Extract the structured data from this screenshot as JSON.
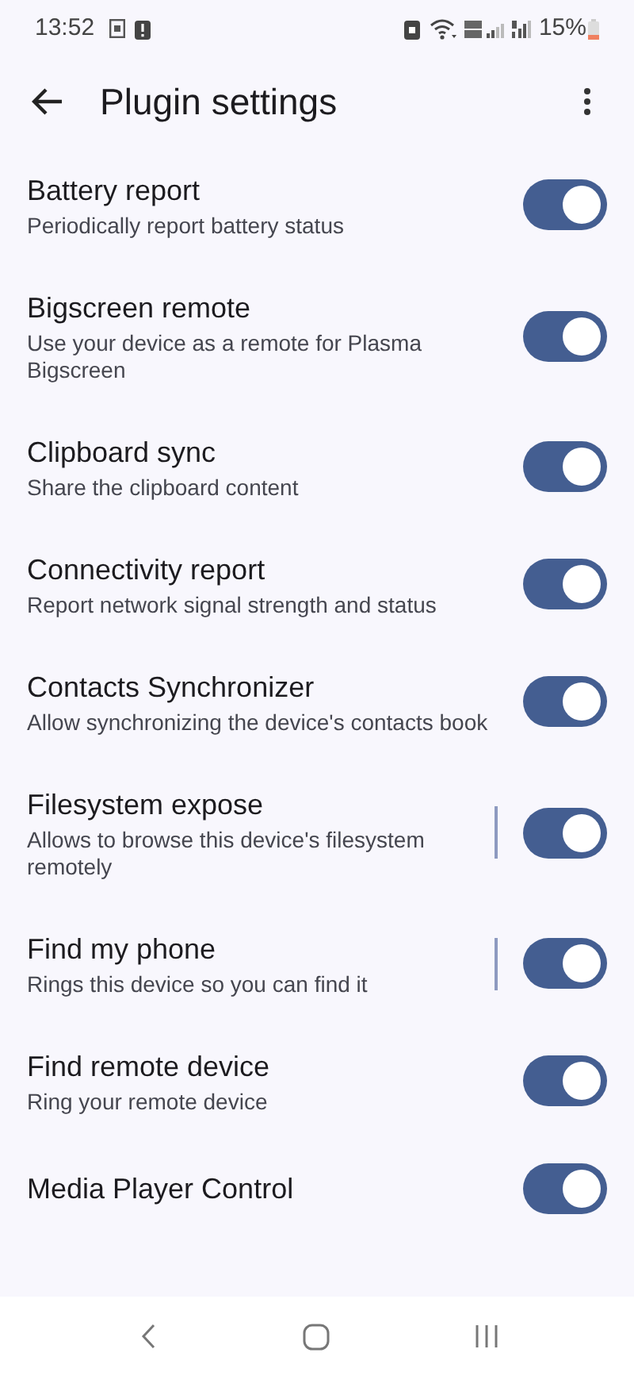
{
  "status_bar": {
    "time": "13:52",
    "battery": "15%"
  },
  "app_bar": {
    "title": "Plugin settings"
  },
  "plugins": [
    {
      "title": "Battery report",
      "subtitle": "Periodically report battery status",
      "on": true,
      "has_settings": false
    },
    {
      "title": "Bigscreen remote",
      "subtitle": "Use your device as a remote for Plasma Bigscreen",
      "on": true,
      "has_settings": false
    },
    {
      "title": "Clipboard sync",
      "subtitle": "Share the clipboard content",
      "on": true,
      "has_settings": false
    },
    {
      "title": "Connectivity report",
      "subtitle": "Report network signal strength and status",
      "on": true,
      "has_settings": false
    },
    {
      "title": "Contacts Synchronizer",
      "subtitle": "Allow synchronizing the device's contacts book",
      "on": true,
      "has_settings": false
    },
    {
      "title": "Filesystem expose",
      "subtitle": "Allows to browse this device's filesystem remotely",
      "on": true,
      "has_settings": true
    },
    {
      "title": "Find my phone",
      "subtitle": "Rings this device so you can find it",
      "on": true,
      "has_settings": true
    },
    {
      "title": "Find remote device",
      "subtitle": "Ring your remote device",
      "on": true,
      "has_settings": false
    },
    {
      "title": "Media Player Control",
      "on": true,
      "has_settings": false
    }
  ]
}
